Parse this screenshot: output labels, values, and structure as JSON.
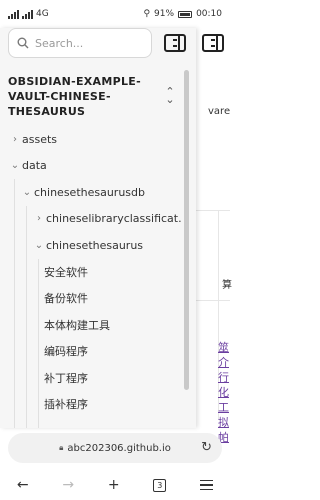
{
  "status_bar": {
    "left": "4G",
    "battery": "91%",
    "time": "00:10"
  },
  "page": {
    "partial_word": "vare",
    "cell_char": "算",
    "vertical_link": "筮介行化工拟帕"
  },
  "sidebar": {
    "search_placeholder": "Search...",
    "vault_title": "OBSIDIAN-EXAMPLE-VAULT-CHINESE-THESAURUS",
    "tree": [
      {
        "label": "assets",
        "expanded": false
      },
      {
        "label": "data",
        "expanded": true
      },
      {
        "label": "chinesethesaurusdb",
        "expanded": true
      },
      {
        "label": "chineselibraryclassificat...",
        "expanded": false
      },
      {
        "label": "chinesethesaurus",
        "expanded": true
      },
      {
        "label": "安全软件"
      },
      {
        "label": "备份软件"
      },
      {
        "label": "本体构建工具"
      },
      {
        "label": "编码程序"
      },
      {
        "label": "补丁程序"
      },
      {
        "label": "插补程序"
      }
    ]
  },
  "browser": {
    "url": "abc202306.github.io",
    "tab_count": "3"
  }
}
